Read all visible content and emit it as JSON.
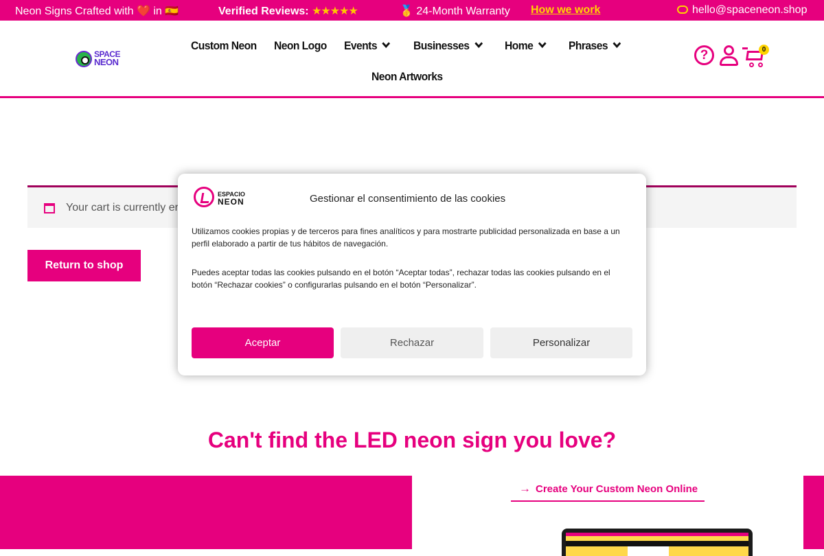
{
  "topbar": {
    "crafted_prefix": "Neon Signs Crafted with",
    "crafted_in": "in",
    "heart": "❤️",
    "flag": "🇪🇸",
    "reviews_label": "Verified Reviews:",
    "stars": "★★★★★",
    "medal": "🥇",
    "warranty": "24-Month Warranty",
    "how_link": "How we work",
    "email": "hello@spaceneon.shop"
  },
  "header": {
    "logo_line1": "SPACE",
    "logo_line2": "NEON",
    "nav": {
      "custom": "Custom Neon",
      "logo": "Neon Logo",
      "events": "Events",
      "businesses": "Businesses",
      "home": "Home",
      "phrases": "Phrases",
      "artworks": "Neon Artworks"
    },
    "help_glyph": "?",
    "cart_count": "0"
  },
  "cart": {
    "empty_notice": "Your cart is currently empty.",
    "visible_notice": "Your cart is currently er",
    "return_label": "Return to shop"
  },
  "cta": {
    "title": "Can't find the LED neon sign you love?",
    "create_link": "Create Your Custom Neon Online",
    "arrow": "→"
  },
  "cookie_modal": {
    "logo_top": "ESPACIO",
    "logo_bottom": "NEON",
    "title": "Gestionar el consentimiento de las cookies",
    "paragraph1": "Utilizamos cookies propias y de terceros para fines analíticos y para mostrarte publicidad personalizada en base a un perfil elaborado a partir de tus hábitos de navegación.",
    "paragraph2": "Puedes aceptar todas las cookies pulsando en el botón “Aceptar todas”, rechazar todas las cookies pulsando en el botón “Rechazar cookies” o configurarlas pulsando en el botón “Personalizar”.",
    "accept": "Aceptar",
    "reject": "Rechazar",
    "customize": "Personalizar"
  },
  "colors": {
    "brand": "#e6007e",
    "accent_yellow": "#ffd400",
    "button_gray": "#efefef"
  }
}
